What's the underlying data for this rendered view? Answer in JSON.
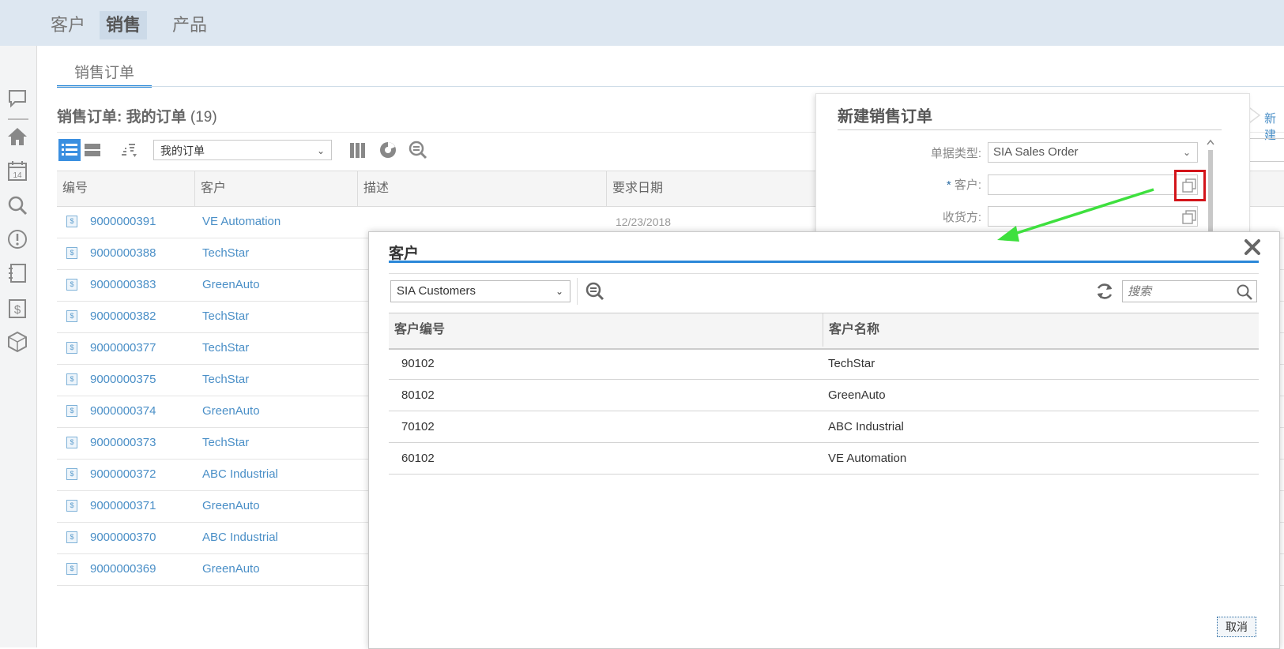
{
  "top_tabs": [
    {
      "label": "客户",
      "active": false
    },
    {
      "label": "销售",
      "active": true
    },
    {
      "label": "产品",
      "active": false
    }
  ],
  "left_icons": [
    "chat-icon",
    "home-icon",
    "calendar-icon",
    "search-icon",
    "alert-icon",
    "notebook-icon",
    "money-document-icon",
    "box-icon"
  ],
  "calendar_day": "14",
  "page_tab": "销售订单",
  "list": {
    "title": "销售订单: 我的订单",
    "count": "(19)",
    "view_select": "我的订单",
    "columns": [
      "编号",
      "客户",
      "描述",
      "要求日期"
    ],
    "rows": [
      {
        "number": "9000000391",
        "customer": "VE Automation",
        "date": "12/23/2018"
      },
      {
        "number": "9000000388",
        "customer": "TechStar",
        "date": ""
      },
      {
        "number": "9000000383",
        "customer": "GreenAuto",
        "date": ""
      },
      {
        "number": "9000000382",
        "customer": "TechStar",
        "date": ""
      },
      {
        "number": "9000000377",
        "customer": "TechStar",
        "date": ""
      },
      {
        "number": "9000000375",
        "customer": "TechStar",
        "date": ""
      },
      {
        "number": "9000000374",
        "customer": "GreenAuto",
        "date": ""
      },
      {
        "number": "9000000373",
        "customer": "TechStar",
        "date": ""
      },
      {
        "number": "9000000372",
        "customer": "ABC Industrial",
        "date": ""
      },
      {
        "number": "9000000371",
        "customer": "GreenAuto",
        "date": ""
      },
      {
        "number": "9000000370",
        "customer": "ABC Industrial",
        "date": ""
      },
      {
        "number": "9000000369",
        "customer": "GreenAuto",
        "date": ""
      }
    ]
  },
  "new_order": {
    "title": "新建销售订单",
    "doc_type_label": "单据类型:",
    "doc_type_value": "SIA Sales Order",
    "customer_required": "*",
    "customer_label": "客户:",
    "customer_value": "",
    "ship_to_label": "收货方:",
    "ship_to_value": "",
    "right_link": "新建"
  },
  "dialog": {
    "title": "客户",
    "select_value": "SIA Customers",
    "search_placeholder": "搜索",
    "columns": [
      "客户编号",
      "客户名称"
    ],
    "rows": [
      {
        "id": "90102",
        "name": "TechStar"
      },
      {
        "id": "80102",
        "name": "GreenAuto"
      },
      {
        "id": "70102",
        "name": "ABC Industrial"
      },
      {
        "id": "60102",
        "name": "VE Automation"
      }
    ],
    "cancel_label": "取消"
  },
  "colors": {
    "accent": "#2b88d8",
    "link": "#4a8fc7",
    "highlight": "#d3141a",
    "annotation_arrow": "#3ee03e"
  }
}
